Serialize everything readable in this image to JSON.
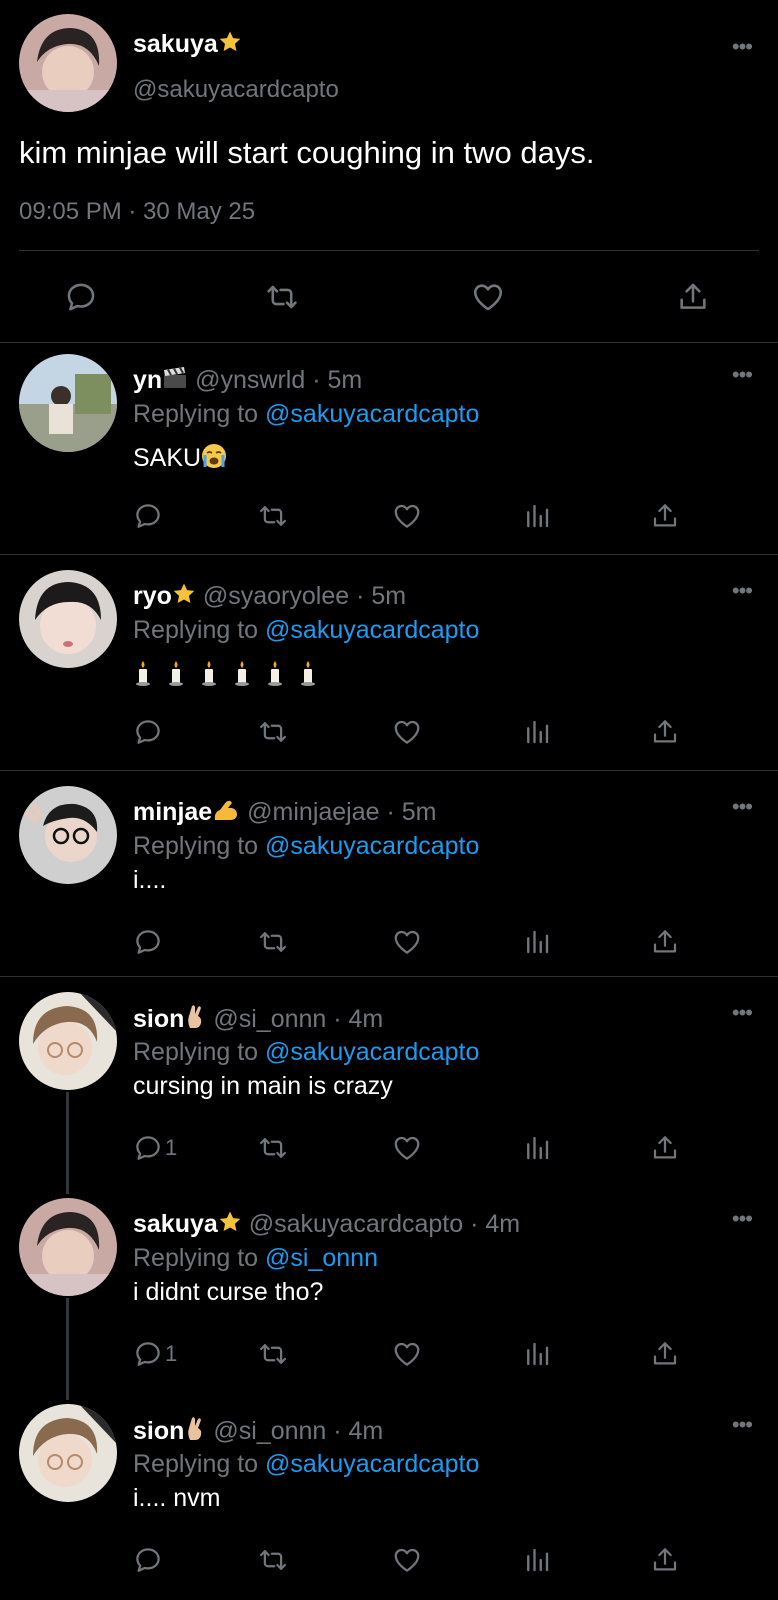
{
  "main": {
    "name": "sakuya",
    "handle": "@sakuyacardcapto",
    "text": "kim minjae will start coughing in two days.",
    "timestamp": "09:05 PM · 30 May 25",
    "more": "•••"
  },
  "replies": [
    {
      "name": "yn",
      "badge": "clapper-emoji",
      "meta": "@ynswrld · 5m",
      "replying_prefix": "Replying to",
      "replying_to": "@sakuyacardcapto",
      "text": "SAKU",
      "text_emoji": "crying-emoji",
      "reply_count": ""
    },
    {
      "name": "ryo",
      "badge": "star-emoji",
      "meta": "@syaoryolee · 5m",
      "replying_prefix": "Replying to",
      "replying_to": "@sakuyacardcapto",
      "text": "",
      "text_emoji": "candle-emoji-x6",
      "reply_count": ""
    },
    {
      "name": "minjae",
      "badge": "flexed-biceps-emoji",
      "meta": "@minjaejae · 5m",
      "replying_prefix": "Replying to",
      "replying_to": "@sakuyacardcapto",
      "text": "i....",
      "reply_count": ""
    },
    {
      "name": "sion",
      "badge": "crossed-fingers-emoji",
      "meta": "@si_onnn · 4m",
      "replying_prefix": "Replying to",
      "replying_to": "@sakuyacardcapto",
      "text": "cursing in main is crazy",
      "reply_count": "1"
    },
    {
      "name": "sakuya",
      "badge": "star-emoji",
      "meta": "@sakuyacardcapto · 4m",
      "replying_prefix": "Replying to",
      "replying_to": "@si_onnn",
      "text": "i didnt curse tho?",
      "reply_count": "1"
    },
    {
      "name": "sion",
      "badge": "crossed-fingers-emoji",
      "meta": "@si_onnn · 4m",
      "replying_prefix": "Replying to",
      "replying_to": "@sakuyacardcapto",
      "text": "i.... nvm",
      "reply_count": ""
    }
  ],
  "colors": {
    "background": "#000000",
    "secondary_text": "#71767b",
    "link": "#1d9bf0",
    "divider": "#2f3336"
  }
}
